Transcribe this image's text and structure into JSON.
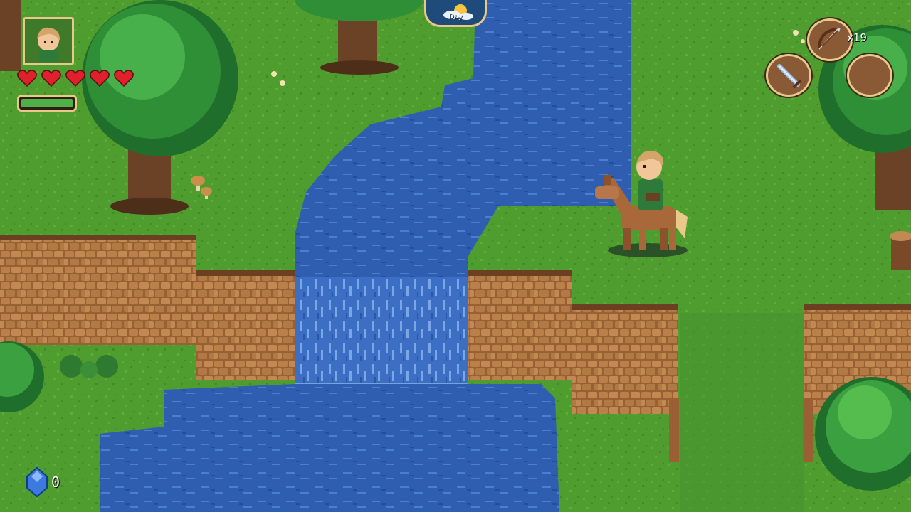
{
  "hud": {
    "time_of_day": "Day",
    "hearts": 5,
    "stamina_level": 1.0,
    "ammo_count": "x19",
    "gem_count": "0",
    "equipped": {
      "ranged": "bow-icon",
      "melee": "sword-icon",
      "extra": "empty-slot"
    }
  },
  "colors": {
    "grass": "#4e9a2f",
    "water": "#2f5fb0",
    "cliff": "#a8693a",
    "heart": "#e0202a",
    "frame": "#e8c98a",
    "stamina": "#4fb04a"
  }
}
